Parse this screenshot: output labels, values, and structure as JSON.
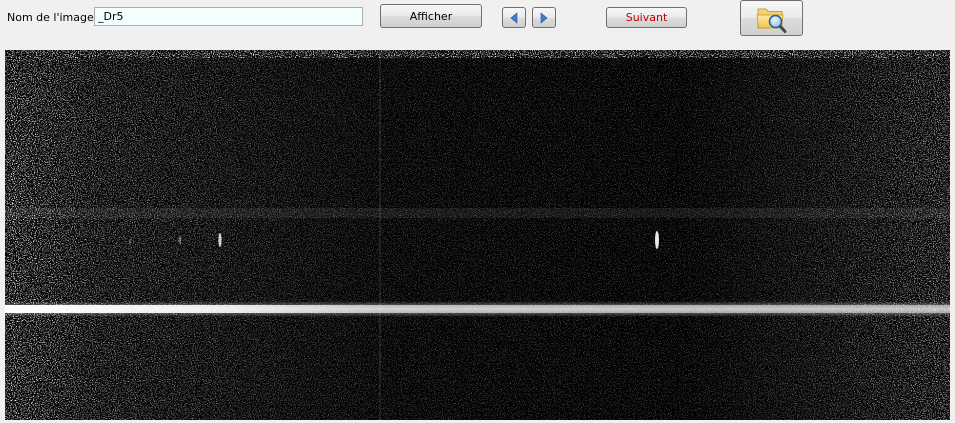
{
  "toolbar": {
    "image_name_label": "Nom de l'image :",
    "image_name_value": "_Dr5",
    "show_button_label": "Afficher",
    "next_button_label": "Suivant",
    "next_button_color": "#c00000",
    "prev_arrow_icon": "triangle-left-icon",
    "next_arrow_icon": "triangle-right-icon",
    "browse_icon": "folder-search-icon",
    "input_background": "#f3ffff"
  },
  "image_view": {
    "background_color": "#000000",
    "trace_color": "#ffffff"
  }
}
